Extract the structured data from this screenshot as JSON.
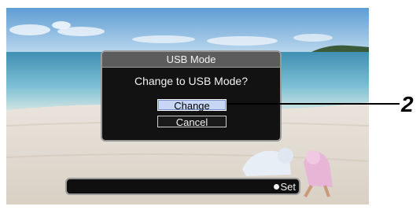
{
  "dialog": {
    "title": "USB Mode",
    "message": "Change to USB Mode?",
    "buttons": [
      {
        "label": "Change",
        "selected": true
      },
      {
        "label": "Cancel",
        "selected": false
      }
    ]
  },
  "status_bar": {
    "set_label": "Set"
  },
  "callout": {
    "label": "2"
  },
  "colors": {
    "dialog_bg": "#121212",
    "selected_button": "#c8d6f5",
    "sky": "#6fa9d8",
    "sea": "#5aa8c8",
    "sand": "#e6e2dc"
  }
}
